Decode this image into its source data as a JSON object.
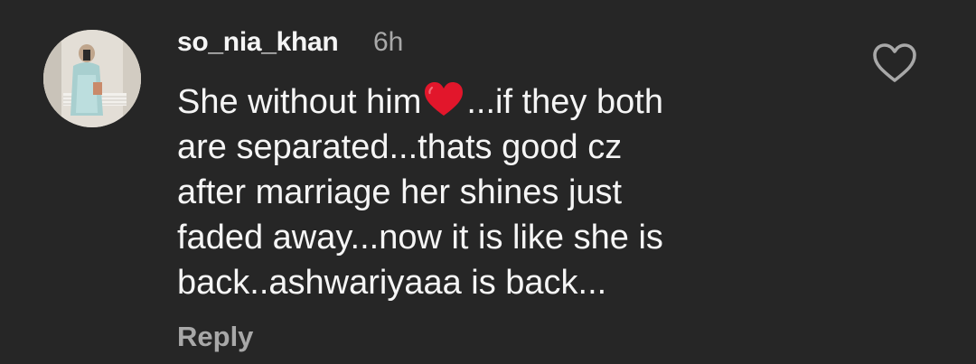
{
  "comment": {
    "username": "so_nia_khan",
    "time": "6h",
    "lines": [
      {
        "before": "She without him",
        "emoji": "red-heart-emoji",
        "after": "...if they both"
      },
      {
        "text": "are separated...thats good cz"
      },
      {
        "text": "after marriage her shines just"
      },
      {
        "text": "faded away...now it is like she is"
      },
      {
        "text": "back..ashwariyaaa is back..."
      }
    ],
    "reply_label": "Reply",
    "like_icon": "heart-outline-icon"
  },
  "colors": {
    "background": "#262626",
    "primary_text": "#f5f5f5",
    "secondary_text": "#a8a8a8",
    "heart_emoji": "#e2162b"
  }
}
